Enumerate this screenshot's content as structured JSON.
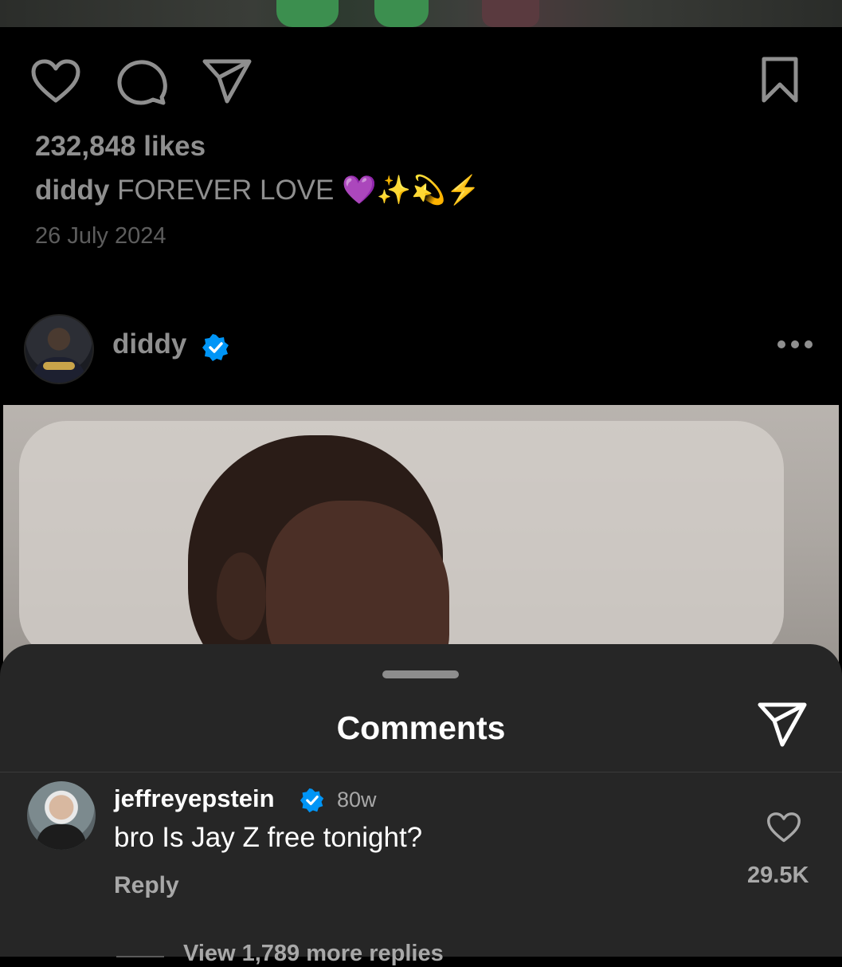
{
  "post": {
    "likes": "232,848 likes",
    "caption_user": "diddy",
    "caption_text": "FOREVER LOVE",
    "caption_emoji": "💜✨💫⚡",
    "date": "26 July 2024"
  },
  "next_post": {
    "username": "diddy",
    "verified": true
  },
  "comments_sheet": {
    "title": "Comments",
    "comment": {
      "username": "jeffreyepstein",
      "verified": true,
      "time": "80w",
      "text": "bro Is Jay Z free tonight?",
      "reply_label": "Reply",
      "like_count": "29.5K",
      "view_replies": "View 1,789 more replies"
    }
  },
  "colors": {
    "background": "#000000",
    "sheet": "#262626",
    "verified_blue": "#0095f6",
    "muted_text": "#8f8f8f"
  },
  "icons": [
    "heart-icon",
    "comment-icon",
    "share-icon",
    "bookmark-icon",
    "verified-icon",
    "more-icon"
  ]
}
